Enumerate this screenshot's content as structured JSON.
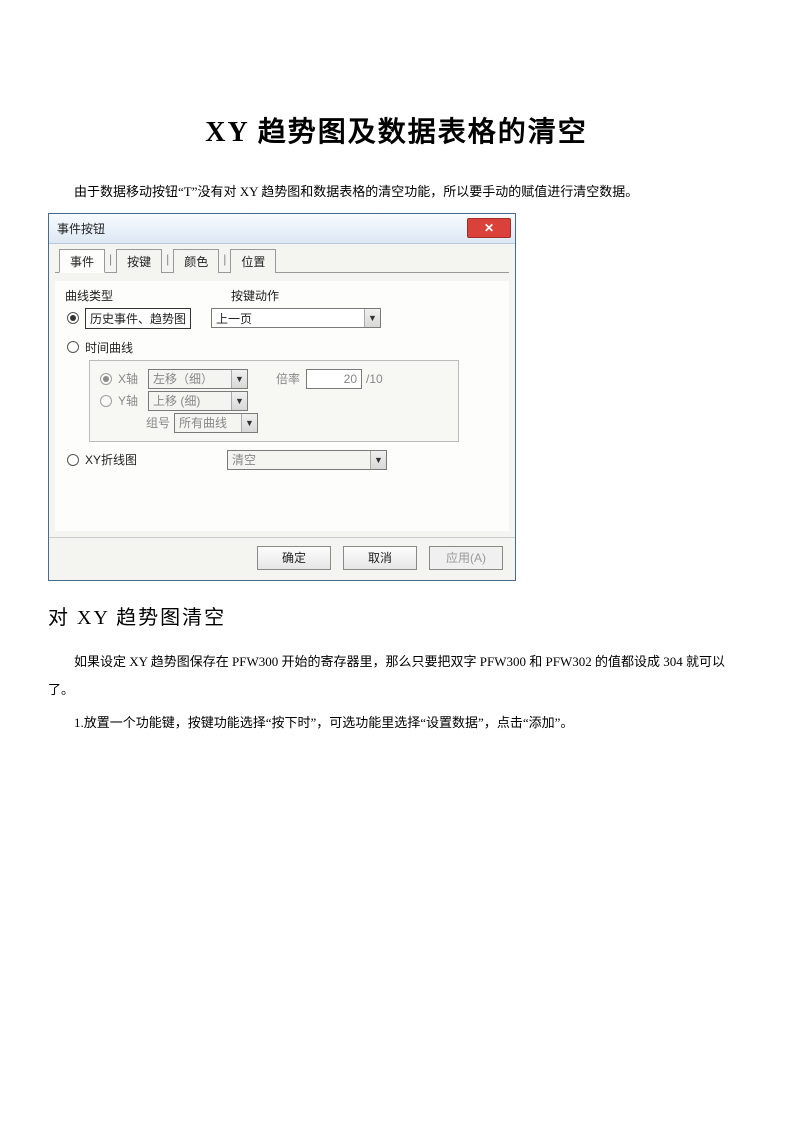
{
  "doc": {
    "title": "XY 趋势图及数据表格的清空",
    "intro": "由于数据移动按钮“T”没有对 XY 趋势图和数据表格的清空功能，所以要手动的赋值进行清空数据。",
    "section_heading": "对 XY 趋势图清空",
    "p2": "如果设定 XY 趋势图保存在 PFW300 开始的寄存器里，那么只要把双字 PFW300 和 PFW302 的值都设成 304 就可以了。",
    "p3": "1.放置一个功能键，按键功能选择“按下时”，可选功能里选择“设置数据”，点击“添加”。"
  },
  "dialog": {
    "title": "事件按钮",
    "tabs": [
      "事件",
      "按键",
      "颜色",
      "位置"
    ],
    "group_curve_type": "曲线类型",
    "group_key_action": "按键动作",
    "opt_history": "历史事件、趋势图",
    "combo_prev_page": "上一页",
    "opt_time_curve": "时间曲线",
    "inner": {
      "x_axis": "X轴",
      "y_axis": "Y轴",
      "x_combo": "左移（细）",
      "y_combo": "上移 (细)",
      "group_label": "组号",
      "group_combo": "所有曲线",
      "rate_label": "倍率",
      "rate_val": "20",
      "rate_suffix": "/10"
    },
    "opt_xy_line": "XY折线图",
    "combo_clear": "清空",
    "buttons": {
      "ok": "确定",
      "cancel": "取消",
      "apply": "应用(A)"
    }
  }
}
